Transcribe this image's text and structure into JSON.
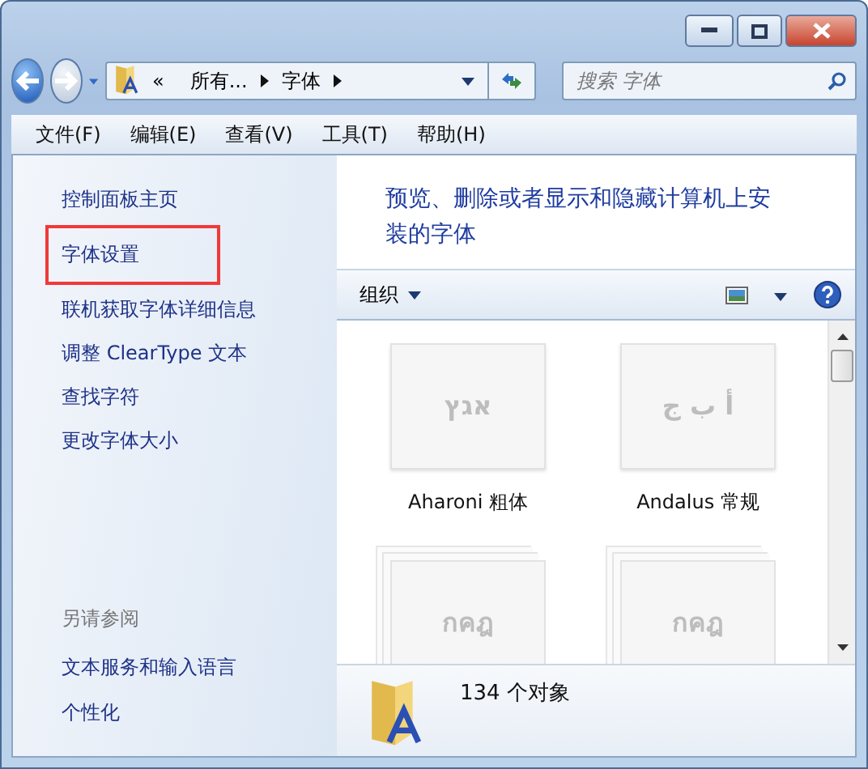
{
  "address_bar": {
    "overflow": "«",
    "crumbs": [
      "所有...",
      "字体"
    ]
  },
  "search": {
    "placeholder": "搜索 字体"
  },
  "menu": [
    "文件(F)",
    "编辑(E)",
    "查看(V)",
    "工具(T)",
    "帮助(H)"
  ],
  "sidebar": {
    "items": [
      {
        "label": "控制面板主页",
        "highlighted": false
      },
      {
        "label": "字体设置",
        "highlighted": true
      },
      {
        "label": "联机获取字体详细信息",
        "highlighted": false
      },
      {
        "label": "调整 ClearType 文本",
        "highlighted": false
      },
      {
        "label": "查找字符",
        "highlighted": false
      },
      {
        "label": "更改字体大小",
        "highlighted": false
      }
    ],
    "see_also": {
      "heading": "另请参阅",
      "items": [
        "文本服务和输入语言",
        "个性化"
      ]
    }
  },
  "header": {
    "description": "预览、删除或者显示和隐藏计算机上安装的字体"
  },
  "toolbar": {
    "organize": "组织"
  },
  "fonts": [
    {
      "kind": "single",
      "sample": "אגץ",
      "label": "Aharoni 粗体"
    },
    {
      "kind": "single",
      "sample": "أ ب ج",
      "label": "Andalus 常规"
    },
    {
      "kind": "family",
      "sample": "กคฎ"
    },
    {
      "kind": "family",
      "sample": "กคฎ"
    }
  ],
  "status": {
    "count": "134 个对象"
  }
}
